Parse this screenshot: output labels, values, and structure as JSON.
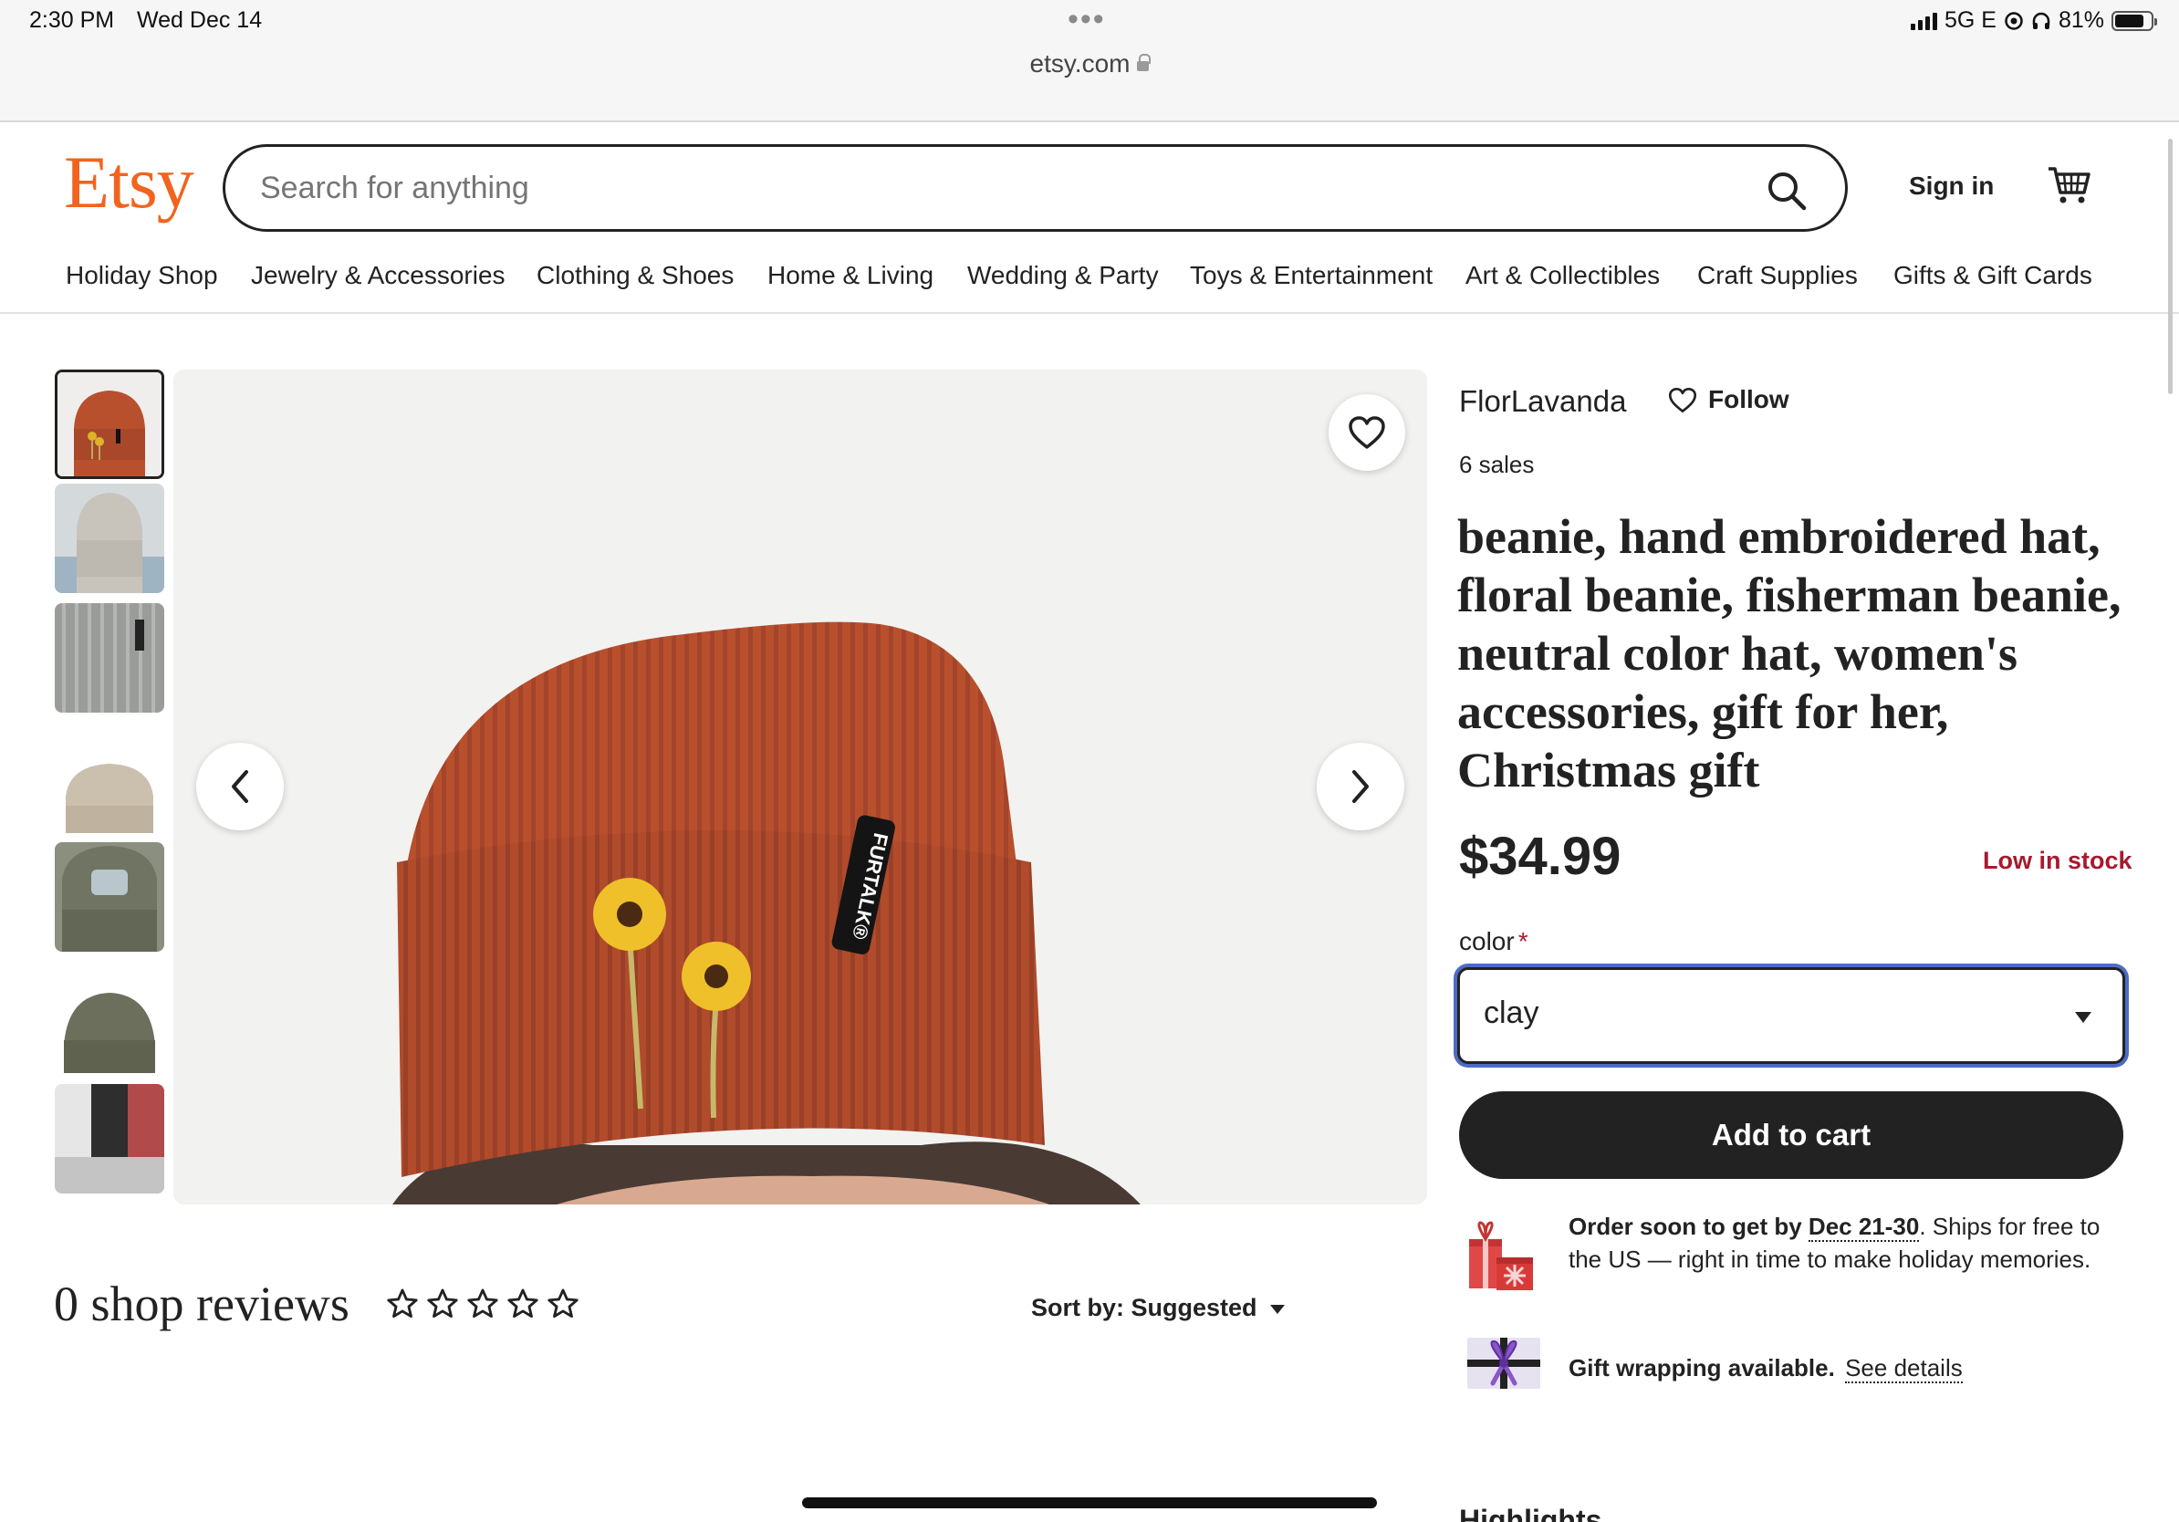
{
  "status_bar": {
    "time": "2:30 PM",
    "date": "Wed Dec 14",
    "url": "etsy.com",
    "network": "5G E",
    "battery": "81%",
    "battery_level": 0.81
  },
  "header": {
    "logo": "Etsy",
    "search_placeholder": "Search for anything",
    "sign_in": "Sign in",
    "brand_color": "#f1641e"
  },
  "nav": [
    "Holiday Shop",
    "Jewelry & Accessories",
    "Clothing & Shoes",
    "Home & Living",
    "Wedding & Party",
    "Toys & Entertainment",
    "Art & Collectibles",
    "Craft Supplies",
    "Gifts & Gift Cards"
  ],
  "product": {
    "shop_name": "FlorLavanda",
    "follow_label": "Follow",
    "sales": "6 sales",
    "title": "beanie, hand embroidered hat, floral beanie, fisherman beanie, neutral color hat, women's accessories, gift for her, Christmas gift",
    "price": "$34.99",
    "stock": "Low in stock",
    "color_label": "color",
    "color_value": "clay",
    "add_to_cart": "Add to cart",
    "image_label": "FURTALK®"
  },
  "shipping": {
    "prefix": "Order soon to get by",
    "date": "Dec 21-30",
    "suffix": ". Ships for free to the US — right in time to make holiday memories."
  },
  "gift": {
    "label": "Gift wrapping available.",
    "link": "See details"
  },
  "reviews": {
    "title": "0 shop reviews",
    "rating": 0,
    "sort_label": "Sort by: Suggested"
  },
  "highlights_label": "Highlights",
  "colors": {
    "accent": "#f1641e",
    "stock_red": "#a61a2e",
    "focus_blue": "#4d6bc6",
    "hat_rust": "#b8502e"
  }
}
